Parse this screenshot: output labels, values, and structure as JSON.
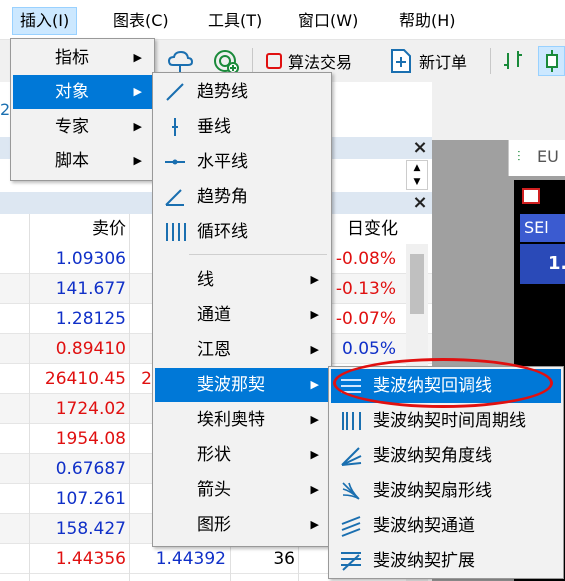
{
  "menubar": [
    "插入(I)",
    "图表(C)",
    "工具(T)",
    "窗口(W)",
    "帮助(H)"
  ],
  "toolbar": {
    "algo_trading": "算法交易",
    "new_order": "新订单"
  },
  "chart_tab_label": "EU",
  "chart_strip": {
    "sell": "SEl",
    "price_digit": "1."
  },
  "left_fragment": "2",
  "market_watch": {
    "col_bid": "卖价",
    "col_daily_change": "日变化",
    "rows": [
      {
        "bid": "1.09306",
        "bid_color": "blue",
        "change": "-0.08%",
        "change_color": "red"
      },
      {
        "bid": "141.677",
        "bid_color": "blue",
        "change": "-0.13%",
        "change_color": "red"
      },
      {
        "bid": "1.28125",
        "bid_color": "blue",
        "change": "-0.07%",
        "change_color": "red"
      },
      {
        "bid": "0.89410",
        "bid_color": "red",
        "change": "0.05%",
        "change_color": "blue"
      },
      {
        "bid": "26410.45",
        "bid_color": "red",
        "ask_fragment": "2",
        "change": "",
        "change_color": ""
      },
      {
        "bid": "1724.02",
        "bid_color": "red",
        "change": "",
        "change_color": ""
      },
      {
        "bid": "1954.08",
        "bid_color": "red",
        "change": "",
        "change_color": ""
      },
      {
        "bid": "0.67687",
        "bid_color": "blue",
        "change": "",
        "change_color": ""
      },
      {
        "bid": "107.261",
        "bid_color": "blue",
        "change": "",
        "change_color": ""
      },
      {
        "bid": "158.427",
        "bid_color": "blue",
        "change": "",
        "change_color": ""
      },
      {
        "bid": "1.44356",
        "bid_color": "red",
        "ask": "1.44392",
        "spread": "36",
        "change": "",
        "change_color": ""
      }
    ]
  },
  "insert_menu": [
    "指标",
    "对象",
    "专家",
    "脚本"
  ],
  "objects_menu": {
    "direct": [
      "趋势线",
      "垂线",
      "水平线",
      "趋势角",
      "循环线"
    ],
    "submenus": [
      "线",
      "通道",
      "江恩",
      "斐波那契",
      "埃利奥特",
      "形状",
      "箭头",
      "图形"
    ]
  },
  "fibonacci_menu": [
    "斐波纳契回调线",
    "斐波纳契时间周期线",
    "斐波纳契角度线",
    "斐波纳契扇形线",
    "斐波纳契通道",
    "斐波纳契扩展"
  ],
  "colors": {
    "highlight": "#0078d7",
    "annotation": "#e01010",
    "positive": "#1030c8",
    "negative": "#e01010"
  }
}
